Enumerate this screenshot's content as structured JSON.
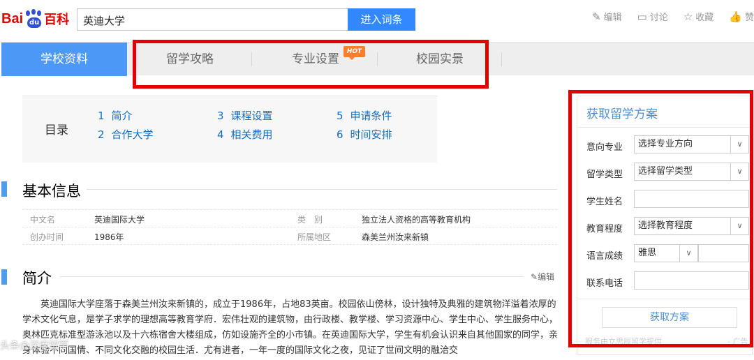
{
  "header": {
    "logo_bai": "Bai",
    "logo_du": "du",
    "logo_baike": "百科",
    "search_value": "英迪大学",
    "search_button": "进入词条",
    "tools": [
      {
        "icon": "pencil-icon",
        "label": "编辑"
      },
      {
        "icon": "comment-icon",
        "label": "讨论"
      },
      {
        "icon": "star-icon",
        "label": "收藏"
      },
      {
        "icon": "thumbs-up-icon",
        "label": "赞"
      }
    ]
  },
  "tabs": [
    {
      "label": "学校资料",
      "active": true
    },
    {
      "label": "留学攻略",
      "active": false
    },
    {
      "label": "专业设置",
      "active": false,
      "badge": "HOT"
    },
    {
      "label": "校园实景",
      "active": false
    }
  ],
  "toc": {
    "title": "目录",
    "items": [
      {
        "num": "1",
        "label": "简介"
      },
      {
        "num": "2",
        "label": "合作大学"
      },
      {
        "num": "3",
        "label": "课程设置"
      },
      {
        "num": "4",
        "label": "相关费用"
      },
      {
        "num": "5",
        "label": "申请条件"
      },
      {
        "num": "6",
        "label": "时间安排"
      }
    ]
  },
  "basic_info": {
    "title": "基本信息",
    "rows": [
      {
        "label1": "中文名",
        "value1": "英迪国际大学",
        "label2": "类　别",
        "value2": "独立法人资格的高等教育机构"
      },
      {
        "label1": "创办时间",
        "value1": "1986年",
        "label2": "所属地区",
        "value2": "森美兰州汝来新镇"
      }
    ]
  },
  "intro": {
    "title": "简介",
    "edit_label": "编辑",
    "paragraph": "英迪国际大学座落于森美兰州汝来新镇的，成立于1986年，占地83英亩。校园依山傍林，设计独特及典雅的建筑物洋溢着浓厚的学术文化气息，是学子求学的理想高等教育学府．宏伟壮观的建筑物，由行政楼、教学楼、学习资源中心、学生中心、学生服务中心，奥林匹克标准型游泳池以及十六栋宿舍大楼组成，仿如设施齐全的小市镇。在英迪国际大学，学生有机会认识来自其他国家的同学，亲身体验不同国情、不同文化交融的校园生活．尤有进者，一年一度的国际文化之夜，见证了世间文明的融洽交"
  },
  "form_panel": {
    "title": "获取留学方案",
    "fields": [
      {
        "label": "意向专业",
        "type": "select",
        "value": "选择专业方向"
      },
      {
        "label": "留学类型",
        "type": "select",
        "value": "选择留学类型"
      },
      {
        "label": "学生姓名",
        "type": "input",
        "value": ""
      },
      {
        "label": "教育程度",
        "type": "select",
        "value": "选择教育程度"
      },
      {
        "label": "语言成绩",
        "type": "select-input",
        "value": "雅思"
      },
      {
        "label": "联系电话",
        "type": "input",
        "value": ""
      }
    ],
    "submit": "获取方案",
    "provider": "服务由立思辰留学提供",
    "ad": "- 广告"
  },
  "watermark": "头条@深度留学"
}
